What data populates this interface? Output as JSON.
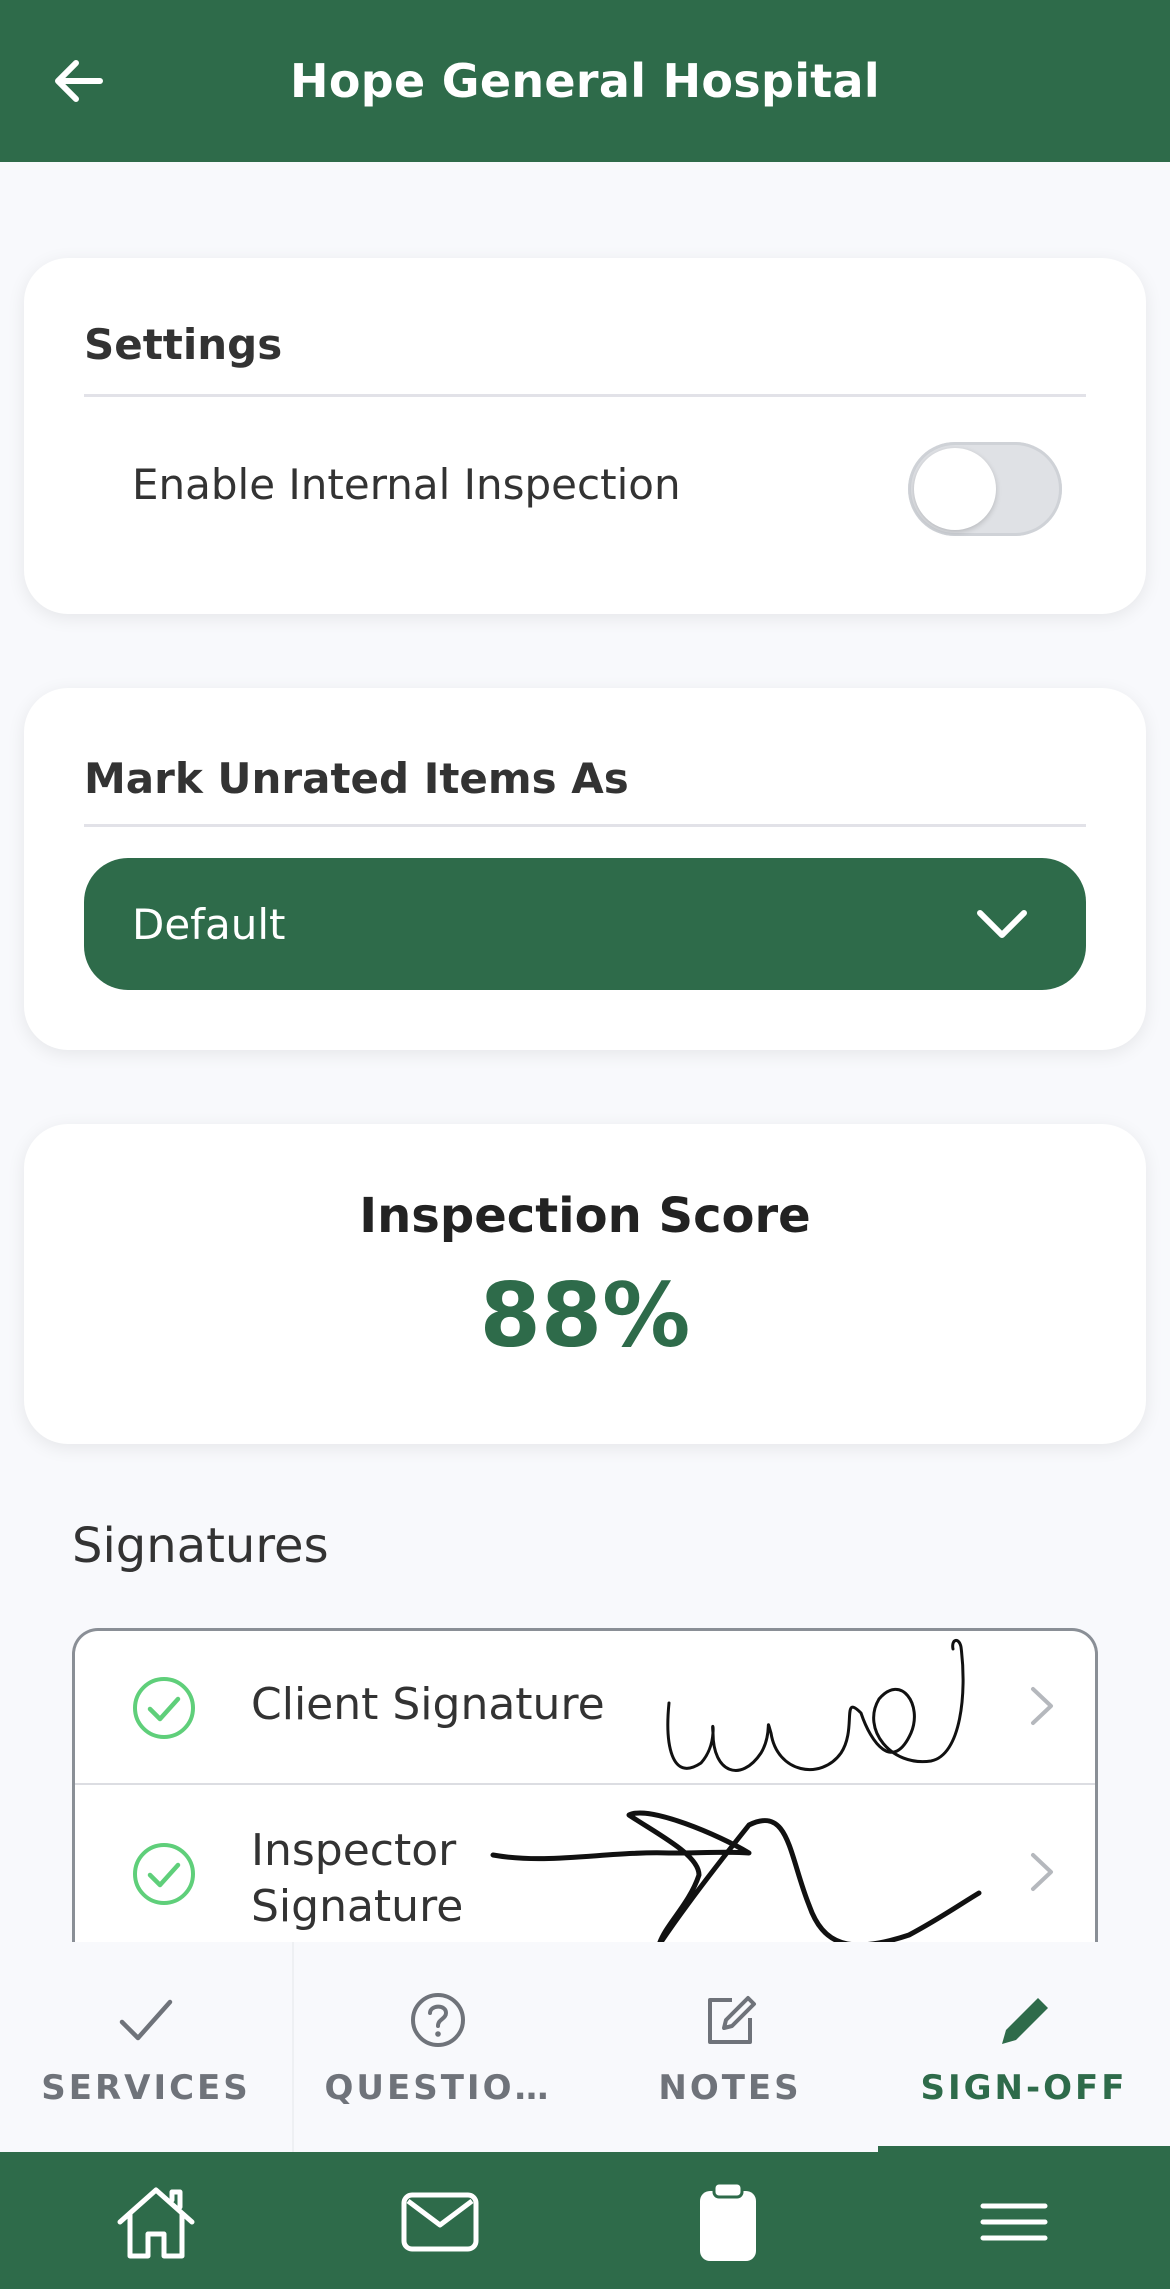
{
  "header": {
    "title": "Hope General Hospital"
  },
  "settings": {
    "heading": "Settings",
    "toggle_label": "Enable Internal Inspection",
    "toggle_on": false
  },
  "unrated": {
    "heading": "Mark Unrated Items As",
    "selected": "Default"
  },
  "score": {
    "label": "Inspection Score",
    "value": "88%"
  },
  "signatures": {
    "title": "Signatures",
    "items": [
      {
        "label": "Client Signature",
        "signed": true
      },
      {
        "label": "Inspector Signature",
        "signed": true
      }
    ]
  },
  "tabs": [
    {
      "label": "SERVICES",
      "icon": "check-icon"
    },
    {
      "label": "QUESTIO…",
      "icon": "question-circle-icon"
    },
    {
      "label": "NOTES",
      "icon": "edit-note-icon"
    },
    {
      "label": "SIGN-OFF",
      "icon": "pencil-icon",
      "active": true
    }
  ],
  "bottom_nav": [
    "home-icon",
    "mail-icon",
    "clipboard-icon",
    "menu-icon"
  ],
  "colors": {
    "brand": "#2e6b4a",
    "check": "#5fcf7a"
  }
}
